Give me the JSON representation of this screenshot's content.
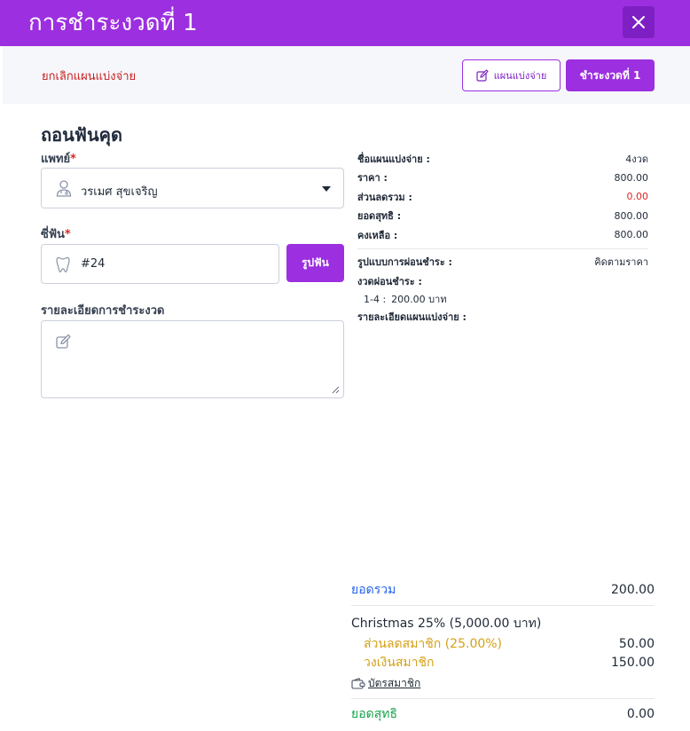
{
  "header": {
    "title": "การชำระงวดที่ 1"
  },
  "toolbar": {
    "cancel_label": "ยกเลิกแผนแบ่งจ่าย",
    "plan_label": "แผนแบ่งจ่าย",
    "pay_label": "ชำระงวดที่ 1"
  },
  "form": {
    "title": "ถอนฟันคุด",
    "doctor_label": "แพทย์",
    "doctor_value": "วรเมศ สุขเจริญ",
    "tooth_label": "ซี่ฟัน",
    "tooth_value": "#24",
    "tooth_button": "รูปฟัน",
    "detail_label": "รายละเอียดการชำระงวด",
    "required_mark": "*"
  },
  "summary": {
    "plan_name_label": "ชื่อแผนแบ่งจ่าย :",
    "plan_name_value": "4งวด",
    "price_label": "ราคา :",
    "price_value": "800.00",
    "discount_label": "ส่วนลดรวม :",
    "discount_value": "0.00",
    "net_label": "ยอดสุทธิ :",
    "net_value": "800.00",
    "remaining_label": "คงเหลือ :",
    "remaining_value": "800.00",
    "method_label": "รูปแบบการผ่อนชำระ :",
    "method_value": "คิดตามราคา",
    "installment_label": "งวดผ่อนชำระ :",
    "installment_range": "1-4 :",
    "installment_value": "200.00 บาท",
    "plan_detail_label": "รายละเอียดแผนแบ่งจ่าย :"
  },
  "totals": {
    "total_label": "ยอดรวม",
    "total_value": "200.00",
    "promo_text": "Christmas 25% (5,000.00 บาท)",
    "member_discount_label": "ส่วนลดสมาชิก (25.00%)",
    "member_discount_value": "50.00",
    "member_credit_label": "วงเงินสมาชิก",
    "member_credit_value": "150.00",
    "member_card_link": "บัตรสมาชิก",
    "net_label": "ยอดสุทธิ",
    "net_value": "0.00"
  },
  "colors": {
    "accent": "#9c2fe0",
    "danger": "#dc2626",
    "link_blue": "#2563eb",
    "gold": "#d4a017",
    "green": "#16a34a"
  }
}
